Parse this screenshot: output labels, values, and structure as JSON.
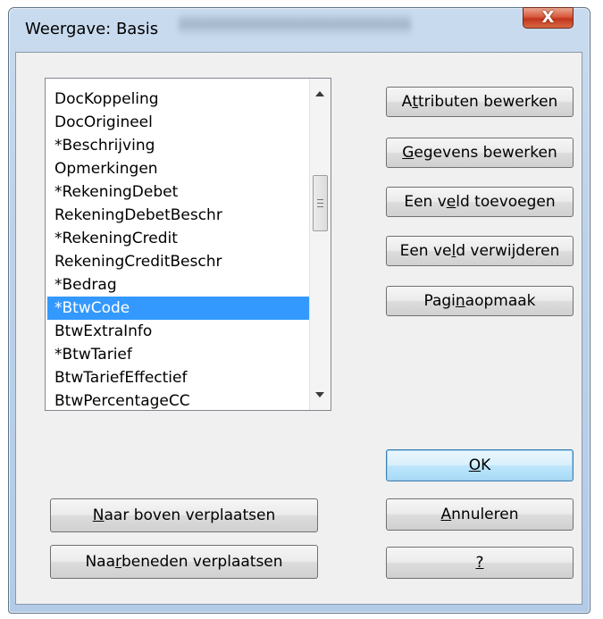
{
  "window": {
    "title": "Weergave: Basis",
    "close_label": "X"
  },
  "fields": [
    "DocKoppeling",
    "DocOrigineel",
    "*Beschrijving",
    "Opmerkingen",
    "*RekeningDebet",
    "RekeningDebetBeschr",
    "*RekeningCredit",
    "RekeningCreditBeschr",
    "*Bedrag",
    "*BtwCode",
    "BtwExtraInfo",
    "*BtwTarief",
    "BtwTariefEffectief",
    "BtwPercentageCC"
  ],
  "selected_field": "*BtwCode",
  "buttons": {
    "attributes": {
      "pre": "A",
      "u": "t",
      "post": "tributen bewerken"
    },
    "data": {
      "pre": "",
      "u": "G",
      "post": "egevens bewerken"
    },
    "add_field": {
      "pre": "Een v",
      "u": "e",
      "post": "ld toevoegen"
    },
    "remove_field": {
      "pre": "Een ve",
      "u": "l",
      "post": "d verwijderen"
    },
    "page_layout": {
      "pre": "Pagi",
      "u": "n",
      "post": "aopmaak"
    },
    "ok": {
      "pre": "",
      "u": "O",
      "post": "K"
    },
    "cancel": {
      "pre": "",
      "u": "A",
      "post": "nnuleren"
    },
    "help": {
      "pre": "",
      "u": "?",
      "post": ""
    },
    "move_up": {
      "pre": "",
      "u": "N",
      "post": "aar boven verplaatsen"
    },
    "move_down": {
      "pre": "Naa",
      "u": "r",
      "post": " beneden verplaatsen"
    }
  }
}
